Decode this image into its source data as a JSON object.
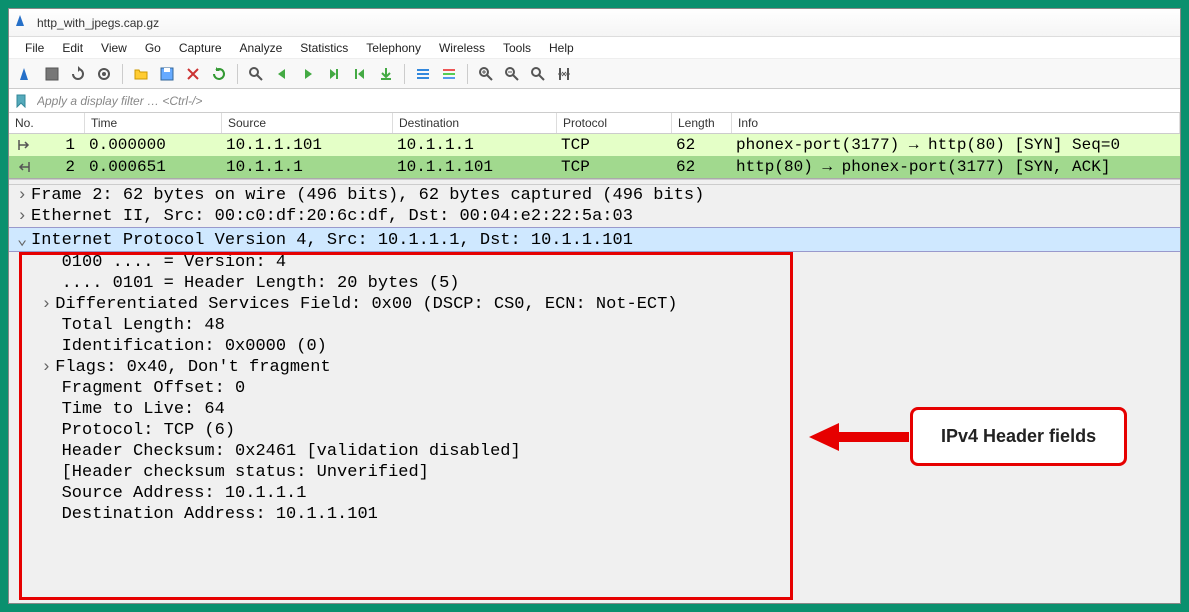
{
  "title": "http_with_jpegs.cap.gz",
  "menus": [
    "File",
    "Edit",
    "View",
    "Go",
    "Capture",
    "Analyze",
    "Statistics",
    "Telephony",
    "Wireless",
    "Tools",
    "Help"
  ],
  "filter_placeholder": "Apply a display filter … <Ctrl-/>",
  "columns": [
    "No.",
    "Time",
    "Source",
    "Destination",
    "Protocol",
    "Length",
    "Info"
  ],
  "rows": [
    {
      "no": "1",
      "time": "0.000000",
      "src": "10.1.1.101",
      "dst": "10.1.1.1",
      "proto": "TCP",
      "len": "62",
      "info": "phonex-port(3177) → http(80) [SYN] Seq=0"
    },
    {
      "no": "2",
      "time": "0.000651",
      "src": "10.1.1.1",
      "dst": "10.1.1.101",
      "proto": "TCP",
      "len": "62",
      "info": "http(80) → phonex-port(3177) [SYN, ACK]"
    }
  ],
  "details": {
    "frame": "Frame 2: 62 bytes on wire (496 bits), 62 bytes captured (496 bits)",
    "eth": "Ethernet II, Src: 00:c0:df:20:6c:df, Dst: 00:04:e2:22:5a:03",
    "ipv4": "Internet Protocol Version 4, Src: 10.1.1.1, Dst: 10.1.1.101",
    "version": "0100 .... = Version: 4",
    "hdrlen": ".... 0101 = Header Length: 20 bytes (5)",
    "dsfield": "Differentiated Services Field: 0x00 (DSCP: CS0, ECN: Not-ECT)",
    "totlen": "Total Length: 48",
    "ident": "Identification: 0x0000 (0)",
    "flags": "Flags: 0x40, Don't fragment",
    "fragoff": "Fragment Offset: 0",
    "ttl": "Time to Live: 64",
    "proto": "Protocol: TCP (6)",
    "cksum": "Header Checksum: 0x2461 [validation disabled]",
    "cksumstat": "[Header checksum status: Unverified]",
    "srcaddr": "Source Address: 10.1.1.1",
    "dstaddr": "Destination Address: 10.1.1.101"
  },
  "callout": "IPv4 Header fields",
  "toolbar_icons": [
    "shark-fin-icon",
    "stop-icon",
    "restart-icon",
    "options-icon",
    "open-icon",
    "save-icon",
    "close-file-icon",
    "reload-icon",
    "find-icon",
    "prev-icon",
    "next-icon",
    "goto-icon",
    "first-icon",
    "last-icon",
    "autoscroll-icon",
    "colorize-icon",
    "zoom-in-icon",
    "zoom-out-icon",
    "zoom-reset-icon",
    "resize-cols-icon"
  ]
}
